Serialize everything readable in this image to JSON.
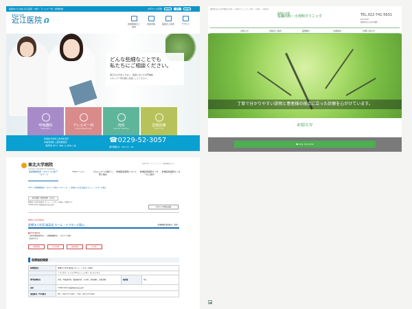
{
  "panel_a": {
    "topbar_text": "医療法人仁泉会 近江医院｜内科・アレルギー科・訪問診療",
    "topbar_fontsize": "文字サイズ変更",
    "topbar_small": "小",
    "topbar_mid": "標準",
    "topbar_large": "大",
    "logo_sub": "医療法人社団",
    "logo_main": "近江医院",
    "logo_mark": "Ω",
    "nav": [
      "診療時間のご案内",
      "診療内容",
      "医院のご案内",
      "アクセス"
    ],
    "hero_line1": "どんな些細なことでも",
    "hero_line2": "私たちにご相談ください。",
    "hero_sub1": "親子まるがあってなし、医療に沿った専門相談",
    "hero_sub2": "スタッフ一同気軽にお話ししてください。",
    "tiles": [
      {
        "label": "呼吸器科",
        "en": "Respiratory",
        "color": "#a78bc9"
      },
      {
        "label": "アレルギー科",
        "en": "Allergy department",
        "color": "#d98a8a"
      },
      {
        "label": "内科",
        "en": "Internal medicine",
        "color": "#5fb59a"
      },
      {
        "label": "訪問診療",
        "en": "Home care",
        "color": "#b7c35a"
      }
    ],
    "footer_line1": "宮城県大崎市三本木新沼字",
    "footer_line2": "JR陸羽東線 上野目駅徒歩",
    "footer_line3": "（駐車場 あり）中央 ○○中央 ○台",
    "phone": "☎0229-52-3057",
    "hours": "受付時間 8：30〜17：30"
  },
  "panel_b": {
    "tiny": "福岡県北九州市戸畑区の内科・小児科クリニック｜内科・小児科・一般外科",
    "logo_sub": "医療法人社団",
    "logo_main": "佐藤内科・小児科クリニック",
    "tel": "TEL.022-741-5631",
    "tel_sub1": "FAX.0120-",
    "tel_sub2": "福岡県北九州市戸畑区",
    "nav": [
      "お知らせ",
      "当院のご案内",
      "医師紹介",
      "交通案内",
      "お問い合わせ"
    ],
    "hero_msg": "丁寧で分かりやすい説明と患者様の視点に立った診療を心がけています。",
    "news_title": "お知らせ",
    "button": "022-741-5631"
  },
  "panel_c": {
    "logo_main": "東北大学病院",
    "logo_en": "TOHOKU UNIVERSITY HOSPITAL",
    "header_right": "病院TOP｜サイトマップ｜医療機関の方へ",
    "nav": [
      "医療機関検索・かかりつけ医データベース",
      "TOPページへ",
      "プロジェクトの紹介と取り組み",
      "地域医療連携について",
      "地域医療連携センターのご案内",
      "地域医療連携センター"
    ],
    "breadcrumb": "TOP ＞ 医療機関検索（かかりつけ医データベース）＞ 医療法人社団 誠英会 ホーム・ドクターズ奥山",
    "back_button": "◀ 前画面（検索結果）に戻る",
    "small1": "医療法人社団 誠英会 ホーム・ドクターズ奥山 の情報です",
    "small2": "〒982-0024 宮城県仙台市太白区",
    "fav_button": "かかりつけ医を追加",
    "category": "医療法人社団 誠英会",
    "title": "医療法人社団 誠英会 ホーム・ドクターズ奥山",
    "title_right": "〔医療機関 検索番号：医院〕",
    "note": "■専門診療科目",
    "info1": "〔専門診療科目区分〕 〔医療機関区分 ：かかりつけ医〕",
    "info2": "【お知らせ】",
    "tabs": [
      "地域情報",
      "在宅訪問",
      "施設情報",
      "その他"
    ],
    "section": "医療施設概要",
    "rows": [
      [
        "医療施設名",
        "医療法人社団 誠英会 ホーム・ドクターズ奥山",
        "",
        ""
      ],
      [
        "",
        "〔フリガナ〕イリョウホウジン シャダン セイエイカイ",
        "",
        ""
      ],
      [
        "専門診療科目",
        "内科、呼吸器内科、循環器内科、小児科、消化器科、訪問診療",
        "病床数",
        "0床"
      ],
      [
        "住所",
        "〒982-0024 宮城県仙台市太白区",
        "",
        ""
      ],
      [
        "電話番号 / FAX番号",
        "TEL：022-277-0491 ／ FAX：022-277-0490",
        "",
        ""
      ]
    ]
  }
}
